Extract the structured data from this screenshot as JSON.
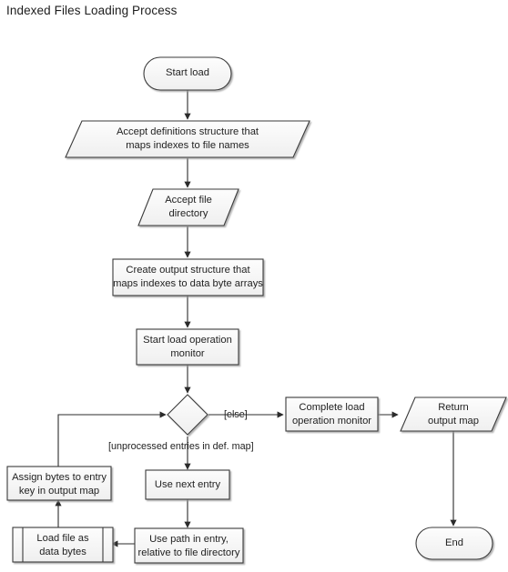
{
  "diagram": {
    "title": "Indexed Files Loading Process",
    "type": "flowchart",
    "style": {
      "node_fill_top": "#fdfdfd",
      "node_fill_bottom": "#f0f0f0",
      "node_stroke": "#3a3a3a",
      "edge_stroke": "#2b2b2b",
      "text_color": "#222222",
      "background": "#ffffff"
    },
    "nodes": [
      {
        "id": "start",
        "shape": "terminator",
        "label": "Start load"
      },
      {
        "id": "accept_defs",
        "shape": "parallelogram",
        "label": "Accept definitions structure that\nmaps indexes to file names"
      },
      {
        "id": "accept_dir",
        "shape": "parallelogram",
        "label": "Accept file\ndirectory"
      },
      {
        "id": "create_output",
        "shape": "process",
        "label": "Create output structure that\nmaps indexes to data byte arrays"
      },
      {
        "id": "start_monitor",
        "shape": "process",
        "label": "Start load operation\nmonitor"
      },
      {
        "id": "decision",
        "shape": "diamond",
        "label": ""
      },
      {
        "id": "complete_monitor",
        "shape": "process",
        "label": "Complete load\noperation monitor"
      },
      {
        "id": "return_map",
        "shape": "parallelogram",
        "label": "Return\noutput map"
      },
      {
        "id": "end",
        "shape": "terminator",
        "label": "End"
      },
      {
        "id": "use_next",
        "shape": "process",
        "label": "Use next entry"
      },
      {
        "id": "use_path",
        "shape": "process",
        "label": "Use path in entry,\nrelative to file directory"
      },
      {
        "id": "load_file",
        "shape": "predefined-process",
        "label": "Load file as\ndata bytes"
      },
      {
        "id": "assign_bytes",
        "shape": "process",
        "label": "Assign bytes to entry\nkey in output map"
      }
    ],
    "edges": [
      {
        "from": "start",
        "to": "accept_defs",
        "label": ""
      },
      {
        "from": "accept_defs",
        "to": "accept_dir",
        "label": ""
      },
      {
        "from": "accept_dir",
        "to": "create_output",
        "label": ""
      },
      {
        "from": "create_output",
        "to": "start_monitor",
        "label": ""
      },
      {
        "from": "start_monitor",
        "to": "decision",
        "label": ""
      },
      {
        "from": "decision",
        "to": "complete_monitor",
        "label": "[else]"
      },
      {
        "from": "decision",
        "to": "use_next",
        "label": "[unprocessed entries in def. map]"
      },
      {
        "from": "complete_monitor",
        "to": "return_map",
        "label": ""
      },
      {
        "from": "return_map",
        "to": "end",
        "label": ""
      },
      {
        "from": "use_next",
        "to": "use_path",
        "label": ""
      },
      {
        "from": "use_path",
        "to": "load_file",
        "label": ""
      },
      {
        "from": "load_file",
        "to": "assign_bytes",
        "label": ""
      },
      {
        "from": "assign_bytes",
        "to": "decision",
        "label": ""
      }
    ]
  }
}
